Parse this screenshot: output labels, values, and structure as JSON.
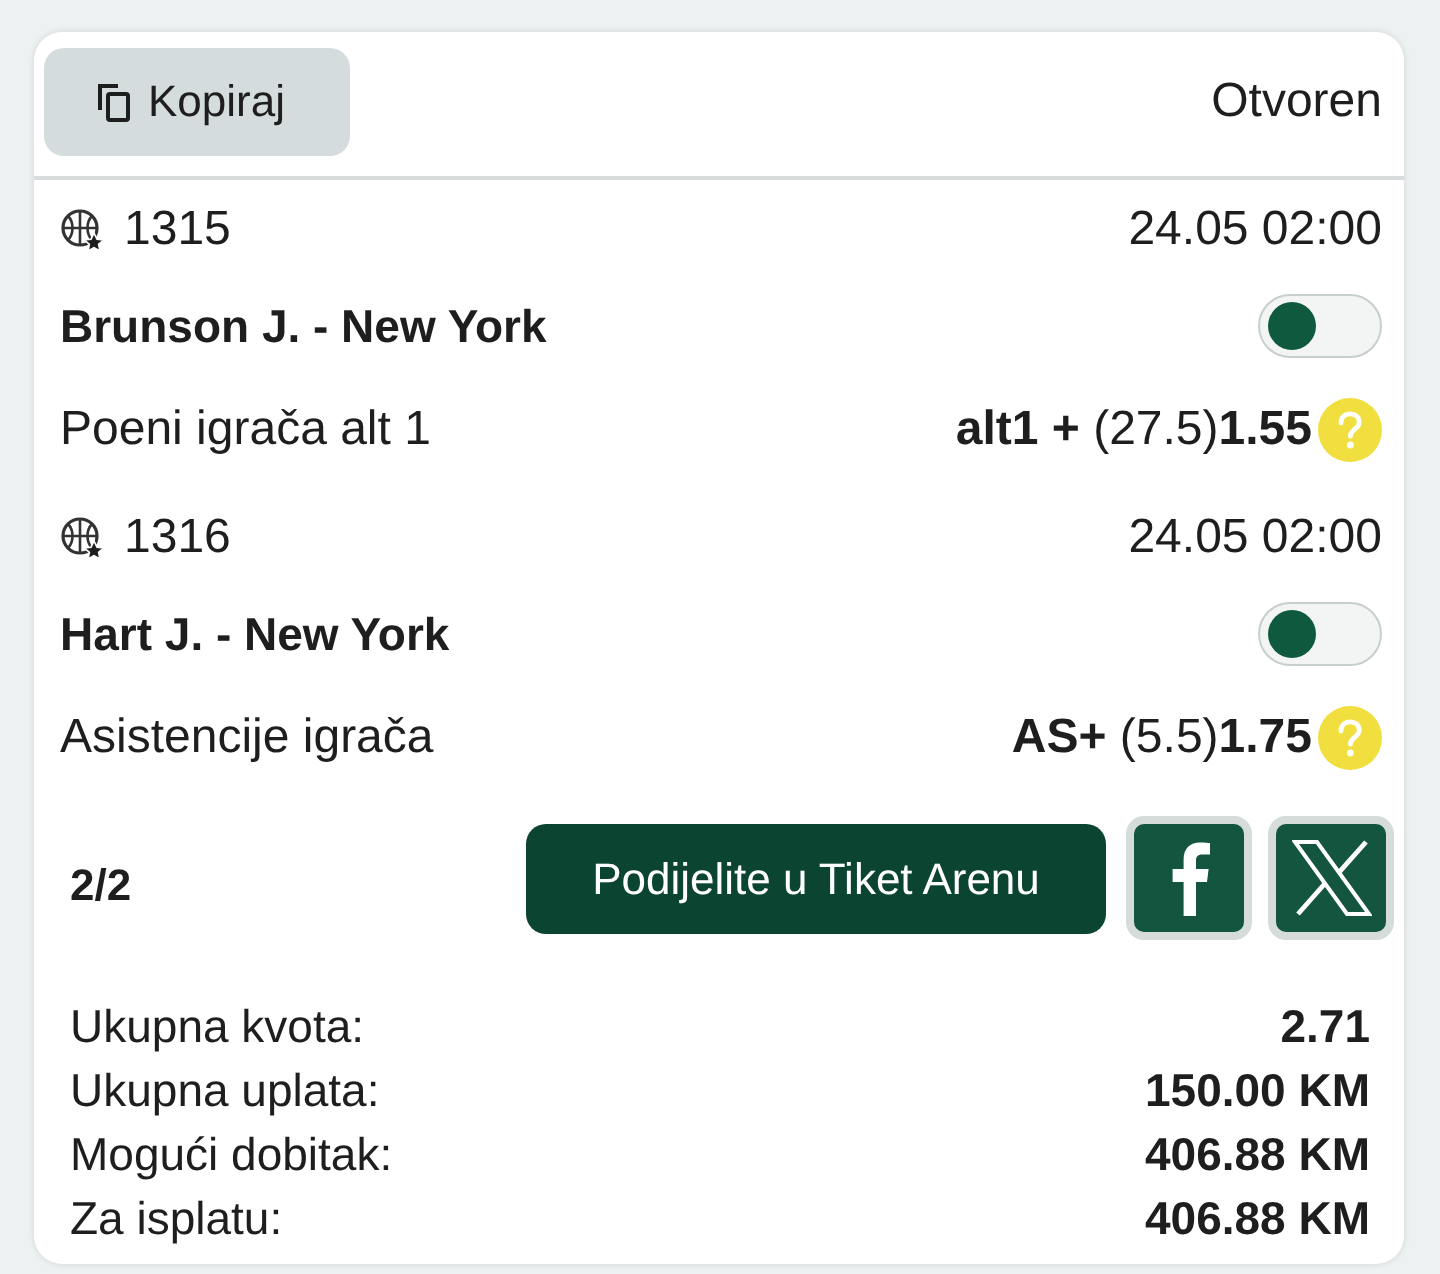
{
  "header": {
    "copy_button": "Kopiraj",
    "status": "Otvoren"
  },
  "events": [
    {
      "code": "1315",
      "datetime": "24.05 02:00",
      "player": "Brunson J. - New York",
      "on": false,
      "market": "Poeni igrača alt 1",
      "selection": "**alt1 +** (27.5)**1.55**"
    },
    {
      "code": "1316",
      "datetime": "24.05 02:00",
      "player": "Hart J. - New York",
      "on": false,
      "market": "Asistencije igrača",
      "selection": "**AS+** (5.5)**1.75**"
    }
  ],
  "footer": {
    "count": "2/2",
    "share_button": "Podijelite u Tiket Arenu"
  },
  "summary": [
    {
      "label": "Ukupna kvota:",
      "value": "2.71"
    },
    {
      "label": "Ukupna uplata:",
      "value": "150.00 KM"
    },
    {
      "label": "Mogući dobitak:",
      "value": "406.88 KM"
    },
    {
      "label": "Za isplatu:",
      "value": "406.88 KM"
    }
  ]
}
